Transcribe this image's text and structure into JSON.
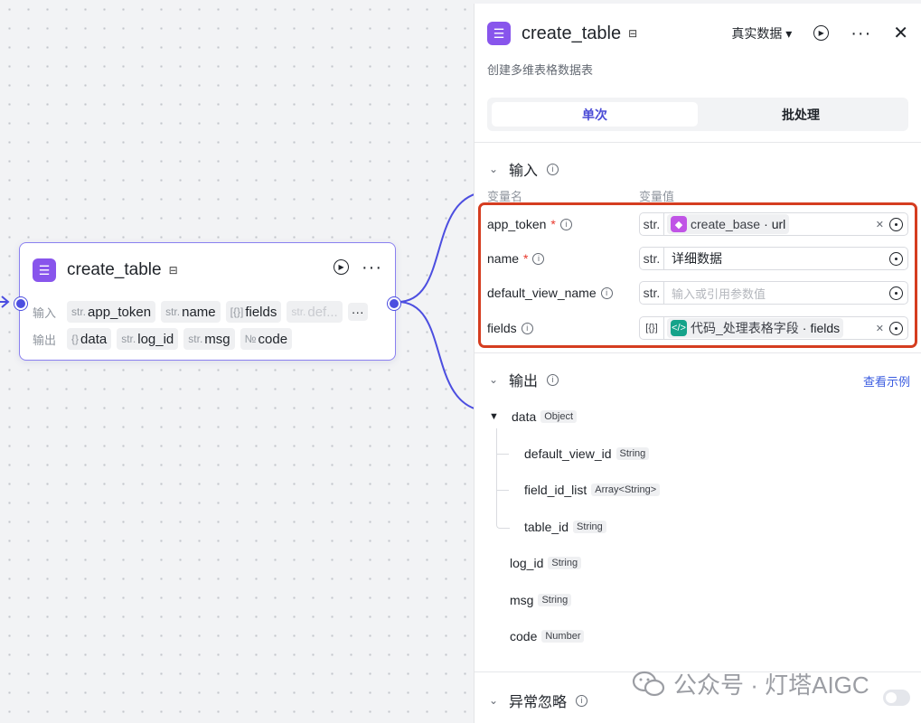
{
  "node": {
    "title": "create_table",
    "input_label": "输入",
    "output_label": "输出",
    "inputs": [
      {
        "type": "str.",
        "name": "app_token"
      },
      {
        "type": "str.",
        "name": "name"
      },
      {
        "type": "[{}]",
        "name": "fields"
      },
      {
        "type": "str.",
        "name": "def..."
      }
    ],
    "more": "···",
    "outputs": [
      {
        "type": "{}",
        "name": "data"
      },
      {
        "type": "str.",
        "name": "log_id"
      },
      {
        "type": "str.",
        "name": "msg"
      },
      {
        "type": "№",
        "name": "code"
      }
    ]
  },
  "panel": {
    "title": "create_table",
    "data_mode": "真实数据",
    "description": "创建多维表格数据表",
    "tabs": [
      "单次",
      "批处理"
    ],
    "input_section": "输入",
    "col_var_name": "变量名",
    "col_var_value": "变量值",
    "params": [
      {
        "name": "app_token",
        "required": true,
        "type": "str.",
        "ref_source": "create_base",
        "ref_field": "url",
        "ref_color": "#c054e6"
      },
      {
        "name": "name",
        "required": true,
        "type": "str.",
        "value": "详细数据"
      },
      {
        "name": "default_view_name",
        "required": false,
        "type": "str.",
        "placeholder": "输入或引用参数值"
      },
      {
        "name": "fields",
        "required": false,
        "type": "[{}]",
        "ref_source": "代码_处理表格字段",
        "ref_field": "fields",
        "ref_color": "#15a38a"
      }
    ],
    "output_section": "输出",
    "view_example": "查看示例",
    "outputs": {
      "data": {
        "name": "data",
        "type": "Object"
      },
      "children": [
        {
          "name": "default_view_id",
          "type": "String"
        },
        {
          "name": "field_id_list",
          "type": "Array<String>"
        },
        {
          "name": "table_id",
          "type": "String"
        }
      ],
      "log_id": {
        "name": "log_id",
        "type": "String"
      },
      "msg": {
        "name": "msg",
        "type": "String"
      },
      "code": {
        "name": "code",
        "type": "Number"
      }
    },
    "error_section": "异常忽略",
    "error_toggle_on": false
  },
  "watermark": "公众号 · 灯塔AIGC",
  "colors": {
    "accent": "#4a4bd6",
    "highlight": "#d53d20",
    "app_icon": "#8855ec"
  }
}
